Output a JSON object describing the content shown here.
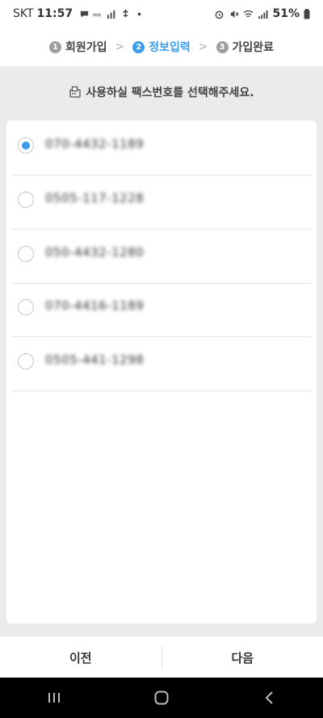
{
  "status_bar": {
    "carrier": "SKT",
    "time": "11:57",
    "battery_pct": "51%"
  },
  "steps": [
    {
      "num": "1",
      "label": "회원가입"
    },
    {
      "num": "2",
      "label": "정보입력"
    },
    {
      "num": "3",
      "label": "가입완료"
    }
  ],
  "instruction": "사용하실 팩스번호를 선택해주세요.",
  "fax_options": [
    {
      "number": "070-4432-1189",
      "selected": true
    },
    {
      "number": "0505-117-1228"
    },
    {
      "number": "050-4432-1280"
    },
    {
      "number": "070-4416-1189"
    },
    {
      "number": "0505-441-1298"
    }
  ],
  "buttons": {
    "prev": "이전",
    "next": "다음"
  },
  "colors": {
    "accent": "#3a9be8",
    "background": "#ebebeb",
    "card": "#ffffff",
    "nav_bar": "#000000"
  },
  "icons": [
    "chat-icon",
    "mw-icon",
    "signal-bars-icon",
    "usb-icon",
    "dot-icon",
    "alarm-icon",
    "mute-icon",
    "wifi-icon",
    "signal-icon",
    "battery-icon",
    "fax-icon",
    "recent-apps-icon",
    "home-icon",
    "back-icon"
  ]
}
